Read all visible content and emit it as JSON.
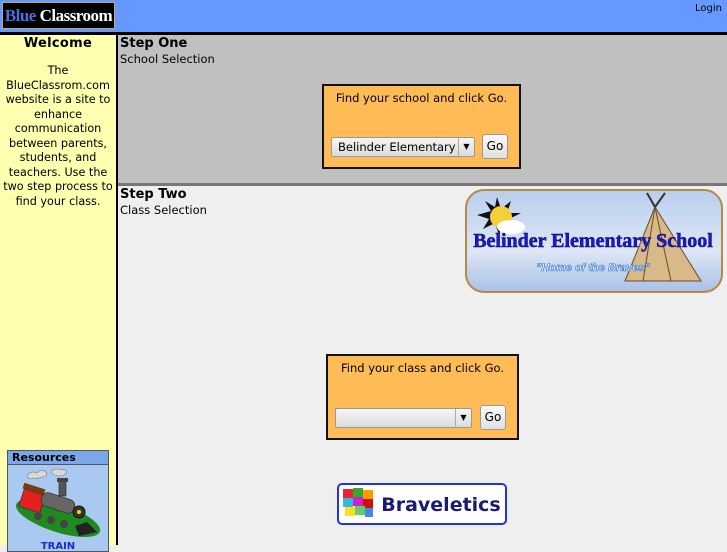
{
  "header": {
    "logo_part1": "Blue",
    "logo_part2": "Classroom",
    "login_label": "Login"
  },
  "sidebar": {
    "welcome_title": "Welcome",
    "blurb": "The BlueClassrom.com website is a site to enhance communication between parents, students, and teachers.  Use the two step process to find your class.",
    "resources": {
      "title": "Resources",
      "link_label": "TRAIN"
    }
  },
  "step_one": {
    "title": "Step One",
    "subtitle": "School Selection",
    "finder": {
      "message": "Find your school and click Go.",
      "selected_school": "Belinder Elementary",
      "go_label": "Go"
    }
  },
  "step_two": {
    "title": "Step Two",
    "subtitle": "Class Selection",
    "banner": {
      "school_name": "Belinder Elementary School",
      "tagline": "\"Home of the Braves\""
    },
    "finder": {
      "message": "Find your class and click Go.",
      "selected_class": "",
      "go_label": "Go"
    },
    "braveletics_label": "Braveletics"
  }
}
